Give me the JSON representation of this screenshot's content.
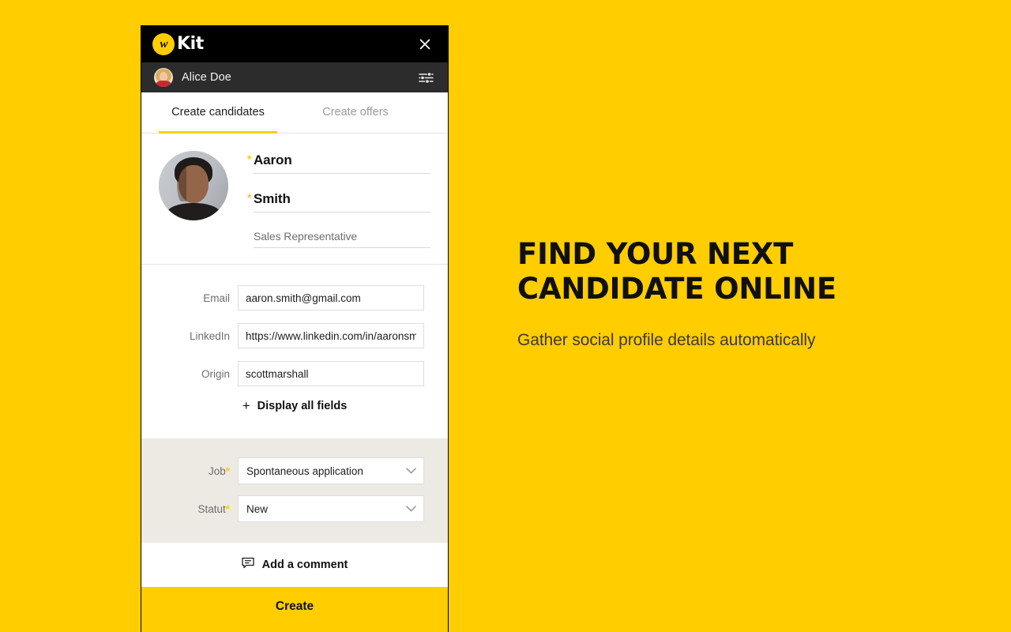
{
  "theme": {
    "brand_yellow": "#FFCD00",
    "header_black": "#000000",
    "user_bar_grey": "#2C2C2C",
    "assign_grey": "#EDE9E3",
    "text_dark": "#111111",
    "text_muted": "#6E6E6E"
  },
  "header": {
    "logo_mark": "w-logo-icon",
    "brand_name": "Kit",
    "close_icon": "close-icon"
  },
  "user_bar": {
    "avatar": "user-avatar",
    "name": "Alice Doe",
    "settings_icon": "sliders-icon"
  },
  "tabs": [
    {
      "label": "Create candidates",
      "active": true
    },
    {
      "label": "Create offers",
      "active": false
    }
  ],
  "identity": {
    "photo": "candidate-photo",
    "first_name": {
      "value": "Aaron",
      "required": true,
      "required_marker": "*"
    },
    "last_name": {
      "value": "Smith",
      "required": true,
      "required_marker": "*"
    },
    "job_title": {
      "value": "Sales Representative",
      "required": false
    }
  },
  "contact_fields": [
    {
      "label": "Email",
      "value": "aaron.smith@gmail.com",
      "name": "email-field"
    },
    {
      "label": "LinkedIn",
      "value": "https://www.linkedin.com/in/aaronsmith",
      "name": "linkedin-field"
    },
    {
      "label": "Origin",
      "value": "scottmarshall",
      "name": "origin-field"
    }
  ],
  "display_all": {
    "plus": "+",
    "label": "Display all fields"
  },
  "assignment": [
    {
      "label": "Job",
      "required_marker": "*",
      "value": "Spontaneous application",
      "name": "job-select",
      "chevron": "chevron-down-icon"
    },
    {
      "label": "Statut",
      "required_marker": "*",
      "value": "New",
      "name": "statut-select",
      "chevron": "chevron-down-icon"
    }
  ],
  "comment": {
    "icon": "comment-bubble-icon",
    "label": "Add a comment"
  },
  "create_button": {
    "label": "Create"
  },
  "marketing": {
    "title_line1": "FIND YOUR NEXT",
    "title_line2": "CANDIDATE ONLINE",
    "subtitle": "Gather social profile details automatically"
  }
}
